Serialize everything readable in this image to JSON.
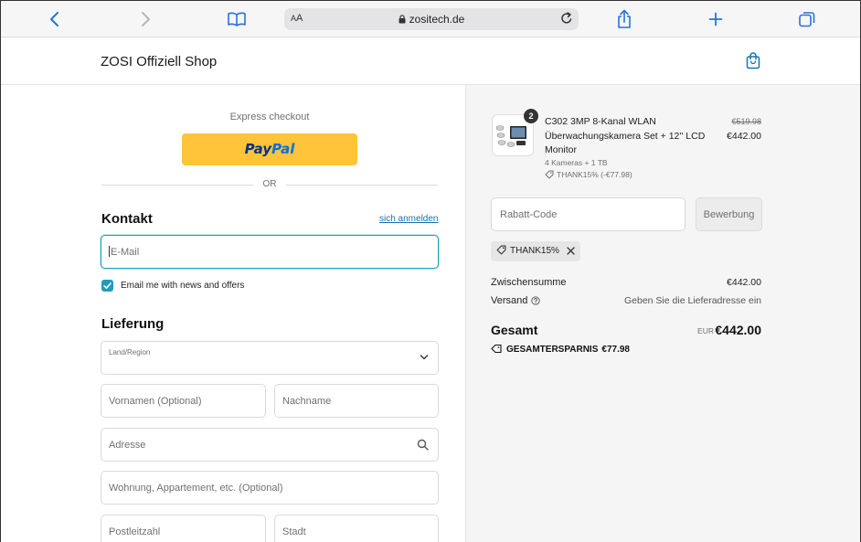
{
  "browser": {
    "aa_label_small": "A",
    "aa_label_big": "A",
    "url": "zositech.de"
  },
  "shop": {
    "title": "ZOSI Offiziell Shop"
  },
  "checkout": {
    "express_label": "Express checkout",
    "paypal_pay": "Pay",
    "paypal_pal": "Pal",
    "or_label": "OR",
    "contact_title": "Kontakt",
    "signin_link": "sich anmelden",
    "email_placeholder": "E-Mail",
    "newsletter_label": "Email me with news and offers",
    "newsletter_checked": true,
    "delivery_title": "Lieferung",
    "country_label": "Land/Region",
    "first_name_placeholder": "Vornamen (Optional)",
    "last_name_placeholder": "Nachname",
    "address_placeholder": "Adresse",
    "apartment_placeholder": "Wohnung, Appartement, etc. (Optional)",
    "zip_placeholder": "Postleitzahl",
    "city_placeholder": "Stadt"
  },
  "summary": {
    "product": {
      "quantity": "2",
      "name": "C302 3MP 8-Kanal WLAN Überwachungskamera Set + 12'' LCD Monitor",
      "variant": "4 Kameras + 1 TB",
      "discount": "THANK15% (-€77.98)",
      "price_old": "€519.98",
      "price_new": "€442.00"
    },
    "discount_placeholder": "Rabatt-Code",
    "apply_label": "Bewerbung",
    "applied_code": "THANK15%",
    "subtotal_label": "Zwischensumme",
    "subtotal_value": "€442.00",
    "shipping_label": "Versand",
    "shipping_value": "Geben Sie die Lieferadresse ein",
    "total_label": "Gesamt",
    "total_currency": "EUR",
    "total_value": "€442.00",
    "savings_label": "GESAMTERSPARNIS",
    "savings_value": "€77.98"
  },
  "colors": {
    "accent": "#1f9dbb",
    "link": "#1773b0",
    "paypal_yellow": "#ffc439"
  }
}
